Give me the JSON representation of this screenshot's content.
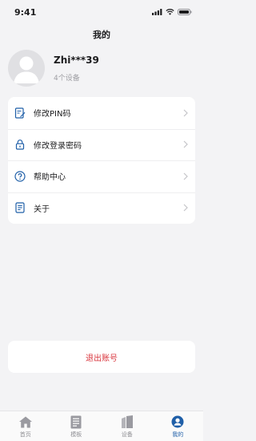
{
  "status_bar": {
    "time": "9:41"
  },
  "header": {
    "title": "我的"
  },
  "profile": {
    "username": "Zhi***39",
    "device_count": "4个设备"
  },
  "menu": {
    "items": [
      {
        "label": "修改PIN码",
        "icon": "edit-document-icon"
      },
      {
        "label": "修改登录密码",
        "icon": "lock-icon"
      },
      {
        "label": "帮助中心",
        "icon": "help-icon"
      },
      {
        "label": "关于",
        "icon": "info-document-icon"
      }
    ]
  },
  "logout": {
    "label": "退出账号"
  },
  "tabs": [
    {
      "label": "首页",
      "icon": "home-icon",
      "active": false
    },
    {
      "label": "模板",
      "icon": "template-icon",
      "active": false
    },
    {
      "label": "设备",
      "icon": "device-icon",
      "active": false
    },
    {
      "label": "我的",
      "icon": "profile-icon",
      "active": true
    }
  ],
  "colors": {
    "accent": "#1f5fa8",
    "danger": "#d9363e",
    "background": "#f3f3f5"
  }
}
